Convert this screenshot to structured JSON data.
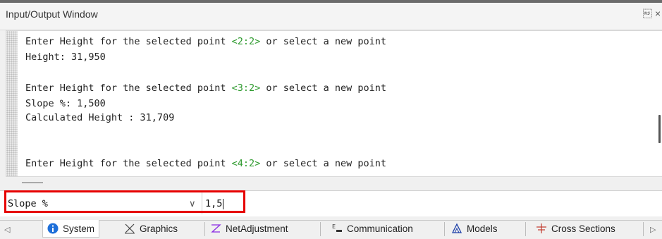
{
  "window": {
    "title": "Input/Output Window",
    "pin_glyph": "Ѱ",
    "close_glyph": "×"
  },
  "output": {
    "lines": [
      {
        "prefix": "Enter Height for the selected point ",
        "point": "<2:2>",
        "suffix": " or select a new point"
      },
      {
        "text": "Height: 31,950"
      },
      {
        "prefix": "Enter Height for the selected point ",
        "point": "<3:2>",
        "suffix": " or select a new point"
      },
      {
        "text": "Slope %: 1,500"
      },
      {
        "text": "Calculated Height : 31,709"
      },
      {
        "prefix": "Enter Height for the selected point ",
        "point": "<4:2>",
        "suffix": " or select a new point"
      }
    ]
  },
  "command": {
    "prompt_label": "Slope %",
    "input_value": "1,5"
  },
  "tabs": [
    {
      "label": "System",
      "icon": "info-icon"
    },
    {
      "label": "Graphics",
      "icon": "graphics-icon"
    },
    {
      "label": "NetAdjustment",
      "icon": "net-adjustment-icon"
    },
    {
      "label": "Communication",
      "icon": "communication-icon"
    },
    {
      "label": "Models",
      "icon": "models-icon"
    },
    {
      "label": "Cross Sections",
      "icon": "cross-sections-icon"
    }
  ],
  "colors": {
    "point_highlight": "#2e9a2e",
    "command_highlight": "#e60000",
    "info_icon": "#1e6fd9"
  }
}
